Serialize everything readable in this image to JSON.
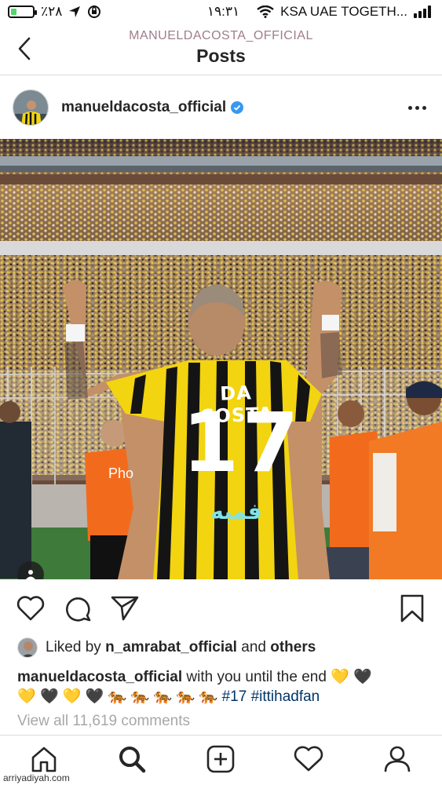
{
  "status_bar": {
    "battery_percent": "٪٢٨",
    "battery_level": 0.28,
    "time": "١٩:٣١",
    "carrier": "KSA UAE TOGETH...",
    "icons": [
      "battery-icon",
      "location-arrow-icon",
      "screen-rotation-lock-icon",
      "wifi-icon",
      "signal-icon"
    ]
  },
  "nav": {
    "username": "MANUELDACOSTA_OFFICIAL",
    "title": "Posts",
    "back_icon": "chevron-left-icon"
  },
  "post": {
    "username": "manueldacosta_official",
    "verified": true,
    "more_icon": "ellipsis-icon",
    "photo": {
      "jersey_name": "DA COSTA",
      "jersey_number": "17",
      "sponsor": "فمبه",
      "vest_text": "Pho"
    },
    "actions": [
      "heart-icon",
      "comment-icon",
      "share-icon",
      "bookmark-icon"
    ],
    "likes": {
      "prefix": "Liked by",
      "user": "n_amrabat_official",
      "connector": "and",
      "others": "others"
    },
    "caption": {
      "user": "manueldacosta_official",
      "text": "with you until the end",
      "emoji_line": [
        "💛",
        "🖤",
        "💛",
        "🖤",
        "💛",
        "🖤",
        "🐅",
        "🐅",
        "🐅",
        "🐅",
        "🐅"
      ],
      "hashtags": [
        "#17",
        "#ittihadfan"
      ]
    },
    "view_comments": "View all 11,619 comments"
  },
  "tab_bar": {
    "tabs": [
      "home-icon",
      "search-icon",
      "new-post-icon",
      "activity-heart-icon",
      "profile-icon"
    ]
  },
  "watermark": "arriyadiyah.com",
  "colors": {
    "accent_blue": "#3897f0",
    "hashtag_blue": "#003569",
    "jersey_yellow": "#f2d410",
    "jersey_black": "#141414",
    "vest_orange": "#f26b1d"
  }
}
